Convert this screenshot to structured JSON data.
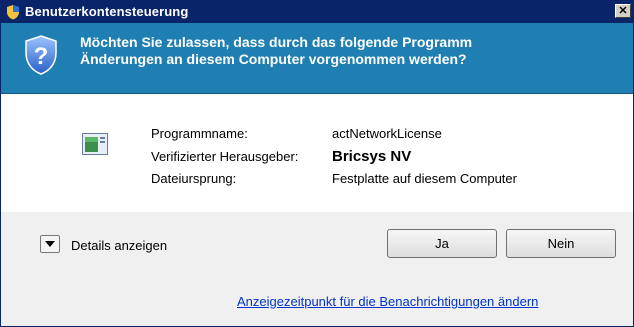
{
  "window": {
    "title": "Benutzerkontensteuerung",
    "close_label": "✕"
  },
  "banner": {
    "line1": "Möchten Sie zulassen, dass durch das folgende Programm",
    "line2": "Änderungen an diesem Computer vorgenommen werden?"
  },
  "info": {
    "program_name_label": "Programmname:",
    "program_name_value": "actNetworkLicense",
    "publisher_label": "Verifizierter Herausgeber:",
    "publisher_value": "Bricsys NV",
    "origin_label": "Dateiursprung:",
    "origin_value": "Festplatte auf diesem Computer"
  },
  "footer": {
    "details_label": "Details anzeigen",
    "yes_label": "Ja",
    "no_label": "Nein",
    "notify_link": "Anzeigezeitpunkt für die Benachrichtigungen ändern"
  },
  "colors": {
    "titlebar": "#0a246a",
    "banner": "#1f7fb2",
    "link": "#0033cc"
  },
  "icons": {
    "title_icon": "uac-shield-icon",
    "banner_icon": "uac-shield-icon",
    "program_icon": "program-window-icon"
  }
}
